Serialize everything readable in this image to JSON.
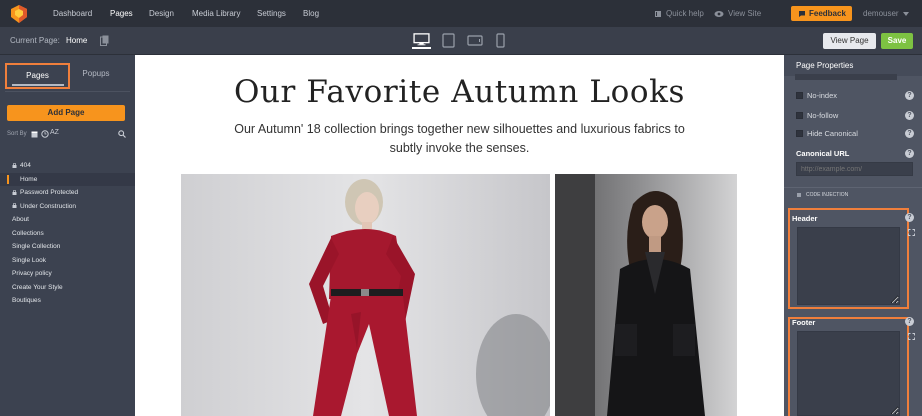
{
  "topbar": {
    "nav": [
      "Dashboard",
      "Pages",
      "Design",
      "Media Library",
      "Settings",
      "Blog"
    ],
    "active_nav": "Pages",
    "quick_help": "Quick help",
    "view_site": "View Site",
    "feedback": "Feedback",
    "user": "demouser",
    "colors": {
      "bg": "#2c3039",
      "accent": "#f7941d"
    }
  },
  "subbar": {
    "current_page_label": "Current Page:",
    "current_page_value": "Home",
    "devices": [
      "desktop-icon",
      "tablet-portrait-icon",
      "tablet-landscape-icon",
      "mobile-icon"
    ],
    "active_device": "desktop-icon",
    "view_page": "View Page",
    "save": "Save",
    "save_color": "#7dc242"
  },
  "sidebar": {
    "tabs": [
      "Pages",
      "Popups"
    ],
    "active_tab": "Pages",
    "add_page": "Add Page",
    "sort_by": "Sort By",
    "sort_az": "AZ",
    "pages": [
      {
        "label": "404",
        "locked": true
      },
      {
        "label": "Home",
        "locked": false,
        "active": true
      },
      {
        "label": "Password Protected",
        "locked": true
      },
      {
        "label": "Under Construction",
        "locked": true
      },
      {
        "label": "About",
        "locked": false
      },
      {
        "label": "Collections",
        "locked": false
      },
      {
        "label": "Single Collection",
        "locked": false
      },
      {
        "label": "Single Look",
        "locked": false
      },
      {
        "label": "Privacy policy",
        "locked": false
      },
      {
        "label": "Create Your Style",
        "locked": false
      },
      {
        "label": "Boutiques",
        "locked": false
      }
    ]
  },
  "canvas": {
    "title": "Our Favorite Autumn Looks",
    "subtitle": "Our Autumn' 18 collection brings together new silhouettes and luxurious fabrics to subtly invoke the senses."
  },
  "panel": {
    "title": "Page Properties",
    "no_index": "No-index",
    "no_follow": "No-follow",
    "hide_canonical": "Hide Canonical",
    "canonical_label": "Canonical URL",
    "canonical_placeholder": "http://example.com/",
    "code_injection": "CODE INJECTION",
    "header_label": "Header",
    "footer_label": "Footer",
    "help_glyph": "?"
  }
}
